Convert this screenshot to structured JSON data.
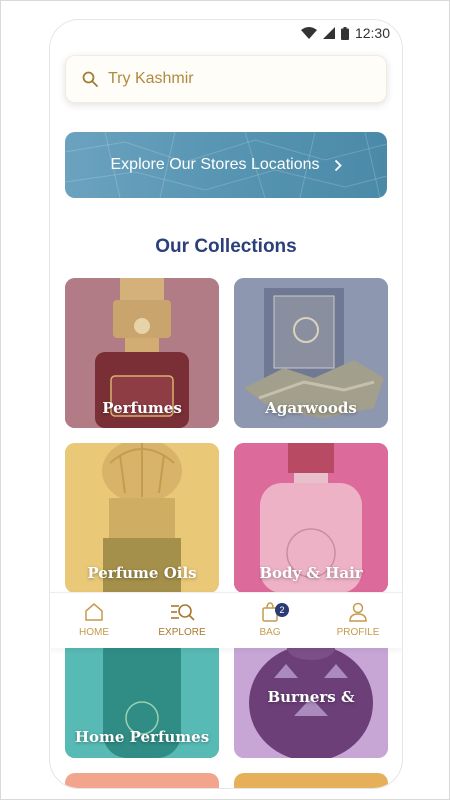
{
  "status_bar": {
    "time": "12:30"
  },
  "search": {
    "placeholder": "Try Kashmir"
  },
  "banner": {
    "label": "Explore Our Stores Locations"
  },
  "collections": {
    "title": "Our Collections",
    "items": [
      {
        "label": "Perfumes"
      },
      {
        "label": "Agarwoods"
      },
      {
        "label": "Perfume Oils"
      },
      {
        "label": "Body & Hair"
      },
      {
        "label": "Home Perfumes"
      },
      {
        "label": "Burners &"
      }
    ]
  },
  "bottom_nav": {
    "items": [
      {
        "label": "HOME",
        "icon": "home-icon"
      },
      {
        "label": "EXPLORE",
        "icon": "explore-icon",
        "active": true
      },
      {
        "label": "BAG",
        "icon": "bag-icon",
        "badge": "2"
      },
      {
        "label": "PROFILE",
        "icon": "profile-icon"
      }
    ]
  },
  "colors": {
    "accent_gold": "#c79a4b",
    "title_navy": "#2b3f7a",
    "banner_blue": "#5795b2"
  }
}
